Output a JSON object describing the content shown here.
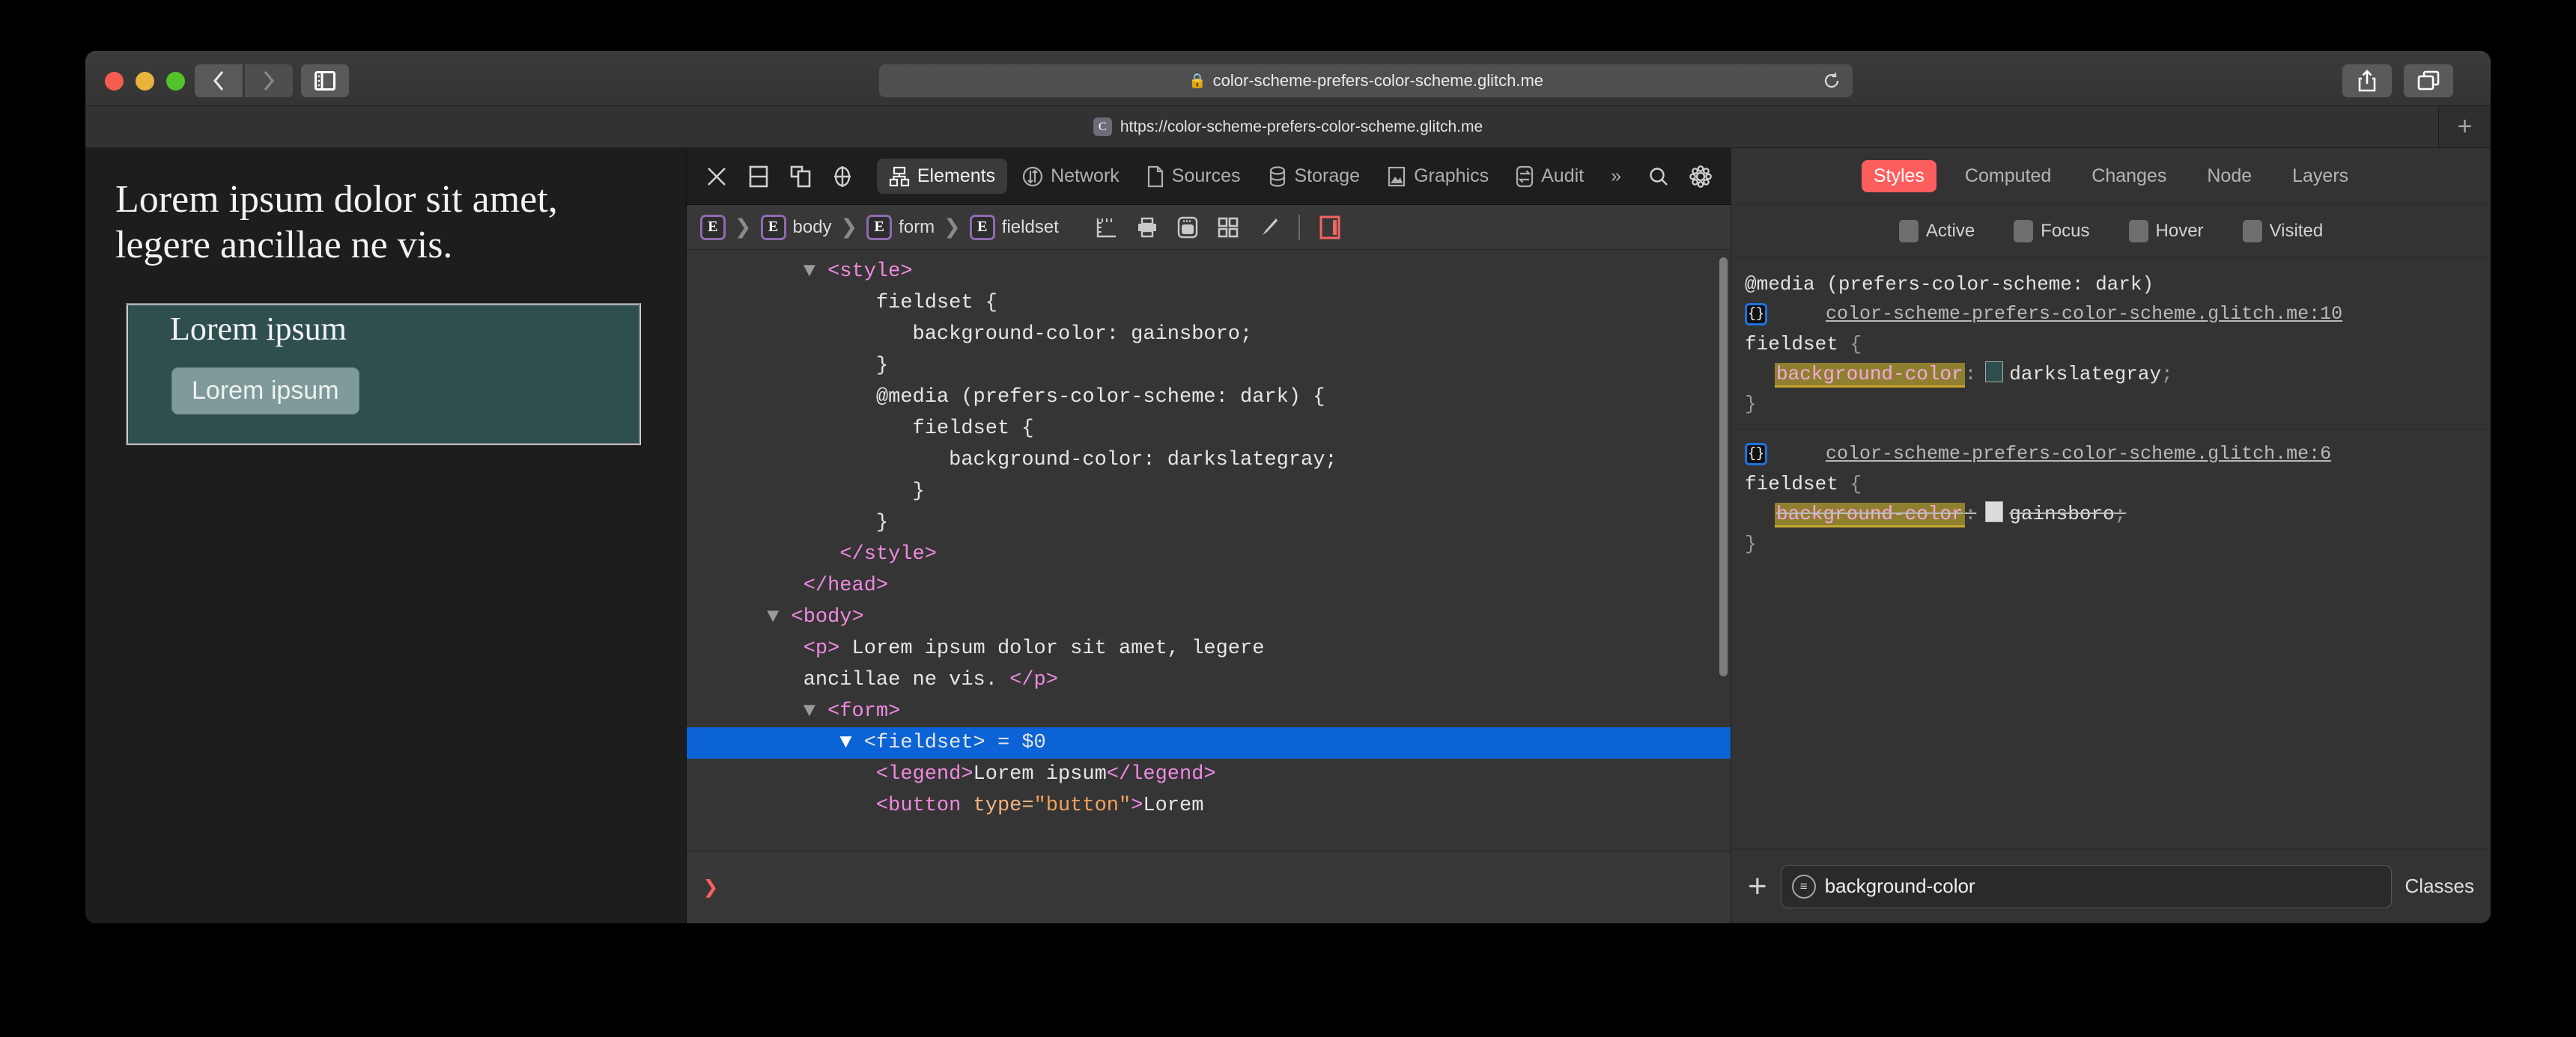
{
  "window": {
    "url_display": "color-scheme-prefers-color-scheme.glitch.me",
    "lock_icon": "lock-icon",
    "reload_icon": "reload-icon",
    "back_icon": "back-chevron-icon",
    "forward_icon": "forward-chevron-icon",
    "sidebar_icon": "sidebar-toggle-icon",
    "share_icon": "share-icon",
    "tabs_overview_icon": "tabs-overview-icon",
    "new_tab_label": "+"
  },
  "tab": {
    "favicon_letter": "C",
    "title": "https://color-scheme-prefers-color-scheme.glitch.me"
  },
  "page": {
    "paragraph": "Lorem ipsum dolor sit amet, legere ancillae ne vis.",
    "legend": "Lorem ipsum",
    "button_label": "Lorem ipsum"
  },
  "devtools": {
    "left_icons": [
      {
        "name": "close-devtools-icon",
        "glyph": "✕"
      },
      {
        "name": "dock-bottom-icon",
        "glyph": ""
      },
      {
        "name": "dock-side-icon",
        "glyph": ""
      },
      {
        "name": "inspect-element-icon",
        "glyph": ""
      }
    ],
    "tabs": [
      {
        "label": "Elements",
        "icon": "elements-icon",
        "active": true
      },
      {
        "label": "Network",
        "icon": "network-icon",
        "active": false
      },
      {
        "label": "Sources",
        "icon": "sources-icon",
        "active": false
      },
      {
        "label": "Storage",
        "icon": "storage-icon",
        "active": false
      },
      {
        "label": "Graphics",
        "icon": "graphics-icon",
        "active": false
      },
      {
        "label": "Audit",
        "icon": "audit-icon",
        "active": false
      }
    ],
    "overflow_label": "»",
    "search_icon": "search-icon",
    "settings_icon": "gear-icon",
    "breadcrumb": [
      {
        "badge": "E",
        "label": ""
      },
      {
        "badge": "E",
        "label": "body"
      },
      {
        "badge": "E",
        "label": "form"
      },
      {
        "badge": "E",
        "label": "fieldset"
      }
    ],
    "breadcrumb_icons": [
      {
        "name": "ruler-icon"
      },
      {
        "name": "print-icon"
      },
      {
        "name": "browser-window-icon"
      },
      {
        "name": "grid-icon"
      },
      {
        "name": "paintbrush-icon"
      },
      {
        "name": "panel-toggle-icon"
      }
    ],
    "dom_lines": [
      {
        "indent": 3,
        "tri": "down",
        "parts": [
          {
            "t": "tag",
            "s": "<style>"
          }
        ]
      },
      {
        "indent": 5,
        "parts": [
          {
            "t": "txt",
            "s": "fieldset {"
          }
        ]
      },
      {
        "indent": 6,
        "parts": [
          {
            "t": "txt",
            "s": "background-color: gainsboro;"
          }
        ]
      },
      {
        "indent": 5,
        "parts": [
          {
            "t": "txt",
            "s": "}"
          }
        ]
      },
      {
        "indent": 5,
        "parts": [
          {
            "t": "txt",
            "s": "@media (prefers-color-scheme: dark) {"
          }
        ]
      },
      {
        "indent": 6,
        "parts": [
          {
            "t": "txt",
            "s": "fieldset {"
          }
        ]
      },
      {
        "indent": 7,
        "parts": [
          {
            "t": "txt",
            "s": "background-color: darkslategray;"
          }
        ]
      },
      {
        "indent": 6,
        "parts": [
          {
            "t": "txt",
            "s": "}"
          }
        ]
      },
      {
        "indent": 5,
        "parts": [
          {
            "t": "txt",
            "s": "}"
          }
        ]
      },
      {
        "indent": 4,
        "parts": [
          {
            "t": "tag",
            "s": "</style>"
          }
        ]
      },
      {
        "indent": 3,
        "parts": [
          {
            "t": "tag",
            "s": "</head>"
          }
        ]
      },
      {
        "indent": 2,
        "tri": "down",
        "parts": [
          {
            "t": "tag",
            "s": "<body>"
          }
        ]
      },
      {
        "indent": 3,
        "parts": [
          {
            "t": "tag",
            "s": "<p>"
          },
          {
            "t": "txt",
            "s": " Lorem ipsum dolor sit amet, legere"
          }
        ]
      },
      {
        "indent": 3,
        "parts": [
          {
            "t": "txt",
            "s": "ancillae ne vis. "
          },
          {
            "t": "tag",
            "s": "</p>"
          }
        ]
      },
      {
        "indent": 3,
        "tri": "down",
        "parts": [
          {
            "t": "tag",
            "s": "<form>"
          }
        ]
      },
      {
        "selected": true,
        "indent": 4,
        "tri": "downwhite",
        "parts": [
          {
            "t": "tagsel",
            "s": "<fieldset>"
          },
          {
            "t": "txt",
            "s": " = $0"
          }
        ]
      },
      {
        "indent": 5,
        "parts": [
          {
            "t": "tag",
            "s": "<legend>"
          },
          {
            "t": "txt",
            "s": "Lorem ipsum"
          },
          {
            "t": "tag",
            "s": "</legend>"
          }
        ]
      },
      {
        "indent": 5,
        "parts": [
          {
            "t": "tag",
            "s": "<button "
          },
          {
            "t": "attr",
            "s": "type="
          },
          {
            "t": "val",
            "s": "\"button\""
          },
          {
            "t": "tag",
            "s": ">"
          },
          {
            "t": "txt",
            "s": "Lorem"
          }
        ]
      }
    ],
    "console_prompt": "❯"
  },
  "styles": {
    "tabs": [
      {
        "label": "Styles",
        "active": true
      },
      {
        "label": "Computed",
        "active": false
      },
      {
        "label": "Changes",
        "active": false
      },
      {
        "label": "Node",
        "active": false
      },
      {
        "label": "Layers",
        "active": false
      }
    ],
    "states": [
      {
        "label": "Active"
      },
      {
        "label": "Focus"
      },
      {
        "label": "Hover"
      },
      {
        "label": "Visited"
      }
    ],
    "rules": [
      {
        "media": "@media (prefers-color-scheme: dark)",
        "source": "color-scheme-prefers-color-scheme.glitch.me:10",
        "selector": "fieldset",
        "property": "background-color",
        "value": "darkslategray",
        "swatch_color": "#2F4F4F",
        "overridden": false,
        "open_brace": "{",
        "close_brace": "}",
        "colon": ":",
        "semicolon": ";"
      },
      {
        "media": "",
        "source": "color-scheme-prefers-color-scheme.glitch.me:6",
        "selector": "fieldset",
        "property": "background-color",
        "value": "gainsboro",
        "swatch_color": "#DCDCDC",
        "overridden": true,
        "open_brace": "{",
        "close_brace": "}",
        "colon": ":",
        "semicolon": ";"
      }
    ],
    "filter": {
      "add_label": "+",
      "icon": "filter-icon",
      "value": "background-color",
      "classes_label": "Classes"
    }
  },
  "colors": {
    "accent_red": "#fc5d5d",
    "selection_blue": "#0b63d6",
    "fieldset_bg": "#2F4F4F",
    "highlight_olive": "#8f8030"
  }
}
